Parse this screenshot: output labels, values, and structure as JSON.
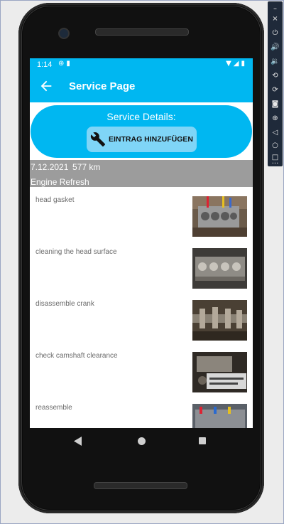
{
  "status_bar": {
    "time": "1:14"
  },
  "app_bar": {
    "title": "Service Page",
    "back_icon": "arrow-left-icon"
  },
  "details": {
    "title": "Service Details:",
    "add_entry_label": "EINTRAG HINZUFÜGEN",
    "icon": "wrench-icon"
  },
  "service": {
    "date": "7.12.2021",
    "mileage": "577 km",
    "name": "Engine Refresh"
  },
  "entries": [
    {
      "label": "head gasket"
    },
    {
      "label": "cleaning the head surface"
    },
    {
      "label": "disassemble crank"
    },
    {
      "label": "check camshaft clearance"
    },
    {
      "label": "reassemble"
    }
  ],
  "colors": {
    "accent": "#00b7f1",
    "button": "#7fd5f7",
    "meta_bg": "#9c9c9c"
  }
}
